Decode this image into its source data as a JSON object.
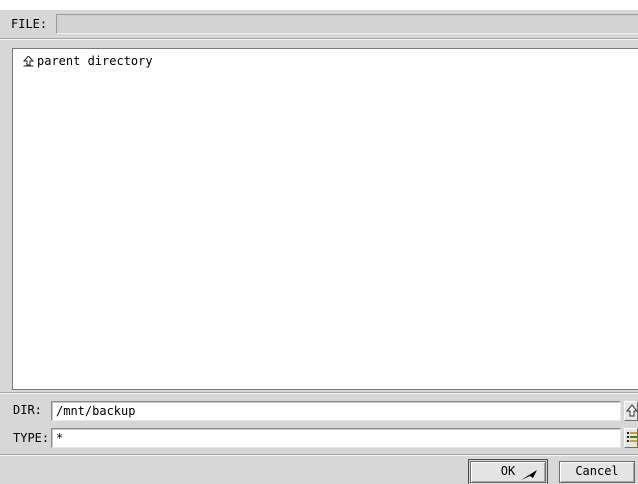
{
  "file": {
    "label": "FILE:",
    "value": ""
  },
  "list": {
    "items": [
      {
        "label": "parent directory",
        "icon": "up-arrow-icon"
      }
    ]
  },
  "dir": {
    "label": "DIR:",
    "value": "/mnt/backup"
  },
  "type": {
    "label": "TYPE:",
    "value": "*"
  },
  "buttons": {
    "ok": "OK",
    "cancel": "Cancel"
  }
}
